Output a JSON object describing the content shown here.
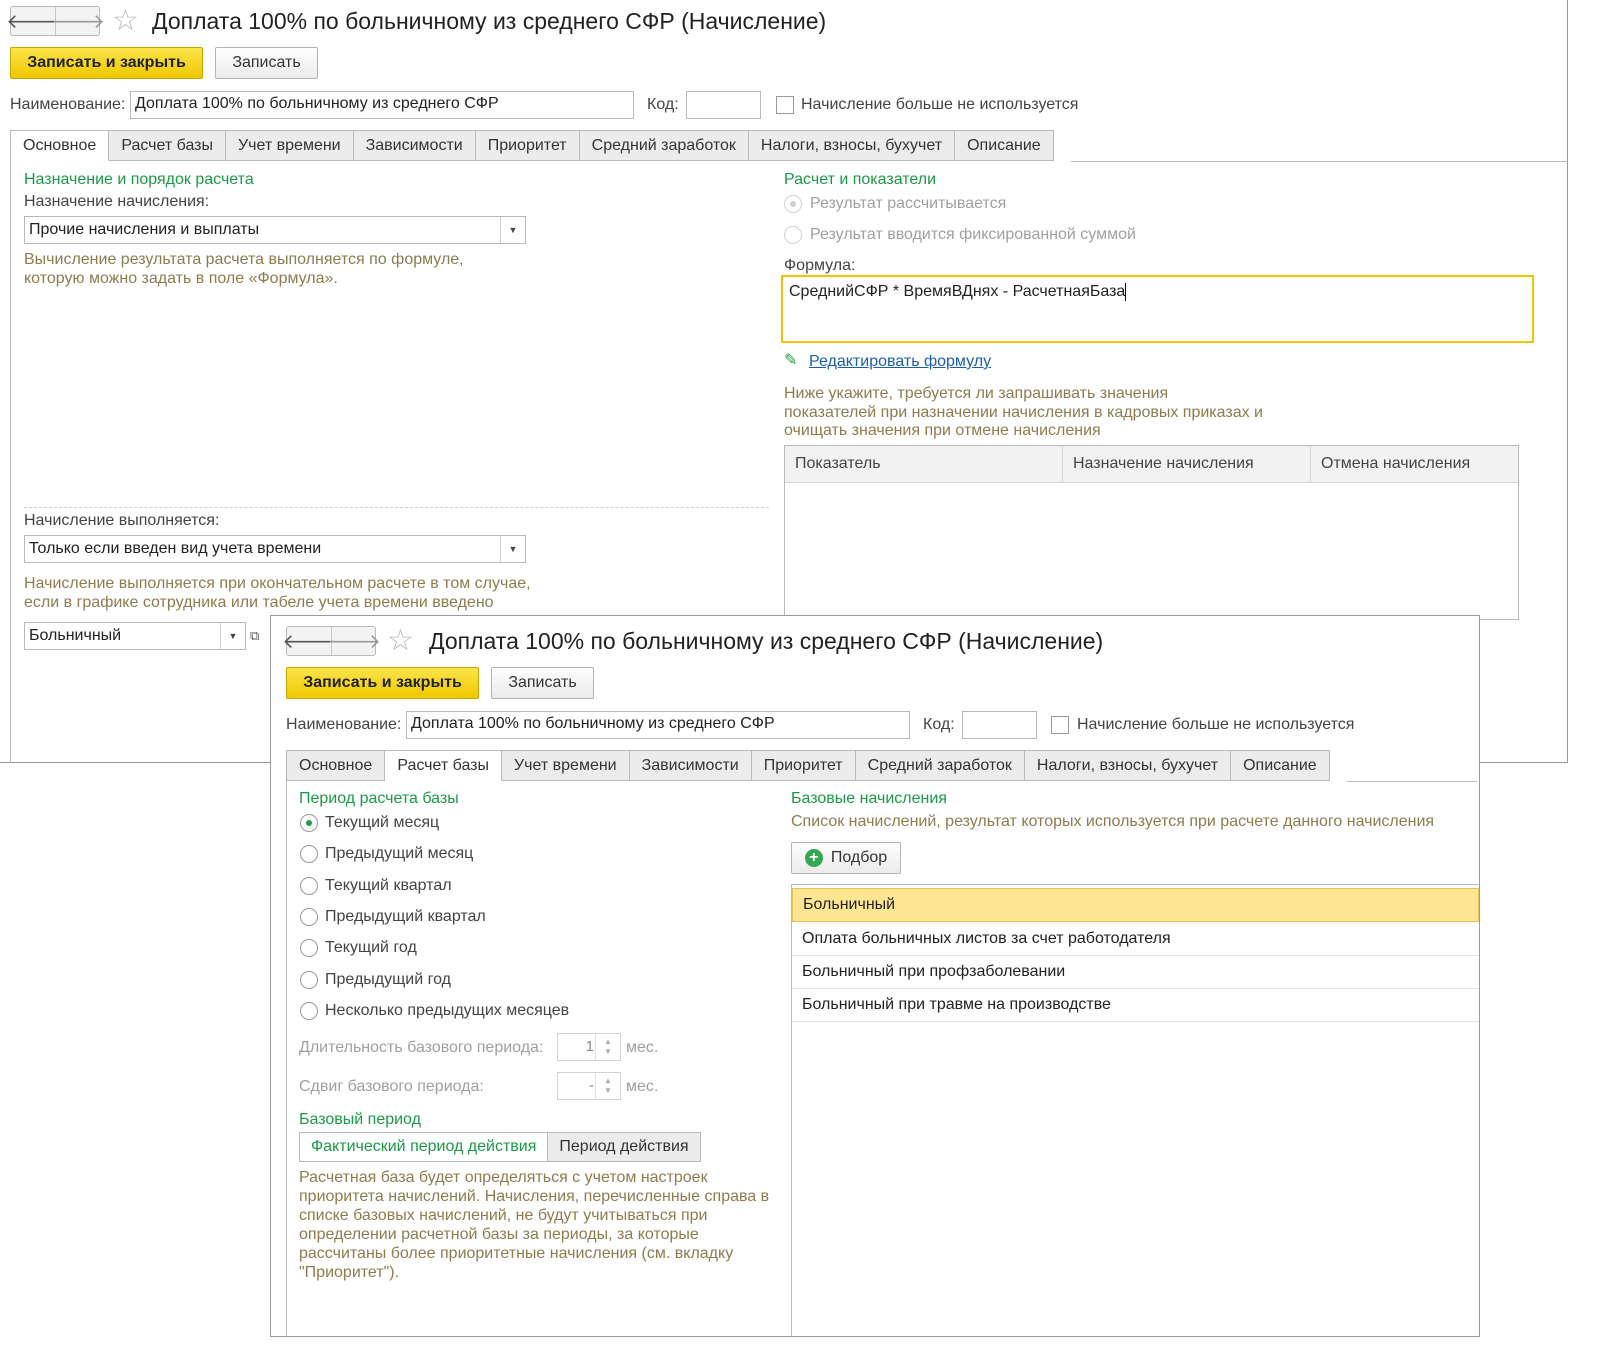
{
  "window1": {
    "title": "Доплата 100% по больничному из среднего СФР (Начисление)",
    "nav": {
      "back": "🡐",
      "forward": "🡒"
    },
    "buttons": {
      "save_close": "Записать и закрыть",
      "save": "Записать"
    },
    "name_label": "Наименование:",
    "name_value": "Доплата 100% по больничному из среднего СФР",
    "code_label": "Код:",
    "code_value": "",
    "unused_label": "Начисление больше не используется",
    "tabs": [
      {
        "label": "Основное",
        "active": true
      },
      {
        "label": "Расчет базы"
      },
      {
        "label": "Учет времени"
      },
      {
        "label": "Зависимости"
      },
      {
        "label": "Приоритет"
      },
      {
        "label": "Средний заработок"
      },
      {
        "label": "Налоги, взносы, бухучет"
      },
      {
        "label": "Описание"
      }
    ],
    "left": {
      "section_title": "Назначение и порядок расчета",
      "purpose_label": "Назначение начисления:",
      "purpose_value": "Прочие начисления и выплаты",
      "purpose_hint_1": "Вычисление результата расчета выполняется по формуле,",
      "purpose_hint_2": "которую можно задать в поле «Формула».",
      "exec_label": "Начисление выполняется:",
      "exec_value": "Только если введен вид учета времени",
      "exec_hint_1": "Начисление выполняется при окончательном расчете в том случае,",
      "exec_hint_2": "если в графике сотрудника или табеле учета времени введено",
      "time_type_value": "Больничный"
    },
    "right": {
      "section_title": "Расчет и показатели",
      "radio_calc": "Результат рассчитывается",
      "radio_fixed": "Результат вводится фиксированной суммой",
      "formula_label": "Формула:",
      "formula_value": "СреднийСФР * ВремяВДнях - РасчетнаяБаза",
      "edit_formula_link": "Редактировать формулу",
      "indicators_hint_1": "Ниже укажите, требуется ли запрашивать значения",
      "indicators_hint_2": "показателей при назначении начисления в кадровых приказах и",
      "indicators_hint_3": "очищать значения при отмене начисления",
      "table_headers": [
        "Показатель",
        "Назначение начисления",
        "Отмена начисления"
      ]
    }
  },
  "window2": {
    "title": "Доплата 100% по больничному из среднего СФР (Начисление)",
    "nav": {
      "back": "🡐",
      "forward": "🡒"
    },
    "buttons": {
      "save_close": "Записать и закрыть",
      "save": "Записать"
    },
    "name_label": "Наименование:",
    "name_value": "Доплата 100% по больничному из среднего СФР",
    "code_label": "Код:",
    "code_value": "",
    "unused_label": "Начисление больше не используется",
    "tabs": [
      {
        "label": "Основное"
      },
      {
        "label": "Расчет базы",
        "active": true
      },
      {
        "label": "Учет времени"
      },
      {
        "label": "Зависимости"
      },
      {
        "label": "Приоритет"
      },
      {
        "label": "Средний заработок"
      },
      {
        "label": "Налоги, взносы, бухучет"
      },
      {
        "label": "Описание"
      }
    ],
    "left": {
      "period_title": "Период расчета базы",
      "periods": [
        {
          "label": "Текущий месяц",
          "selected": true
        },
        {
          "label": "Предыдущий месяц"
        },
        {
          "label": "Текущий квартал"
        },
        {
          "label": "Предыдущий квартал"
        },
        {
          "label": "Текущий год"
        },
        {
          "label": "Предыдущий год"
        },
        {
          "label": "Несколько предыдущих месяцев"
        }
      ],
      "duration_label": "Длительность базового периода:",
      "duration_value": "1",
      "duration_unit": "мес.",
      "shift_label": "Сдвиг базового периода:",
      "shift_value": "-",
      "shift_unit": "мес.",
      "base_period_title": "Базовый период",
      "segment_active": "Фактический период действия",
      "segment_inactive": "Период действия",
      "hint": "Расчетная база будет определяться с учетом настроек приоритета начислений. Начисления, перечисленные справа в списке базовых начислений, не будут учитываться при определении расчетной базы за периоды, за которые рассчитаны более приоритетные начисления (см. вкладку \"Приоритет\")."
    },
    "right": {
      "title": "Базовые начисления",
      "subtitle": "Список начислений, результат которых используется при расчете данного начисления",
      "pick_button": "Подбор",
      "items": [
        "Больничный",
        "Оплата больничных листов за счет работодателя",
        "Больничный при профзаболевании",
        "Больничный при травме на производстве"
      ]
    }
  },
  "colors": {
    "accent_green": "#1b9a45",
    "primary_button": "#f5d21f",
    "selection": "#fde592",
    "hint_text": "#8e7c4f"
  }
}
